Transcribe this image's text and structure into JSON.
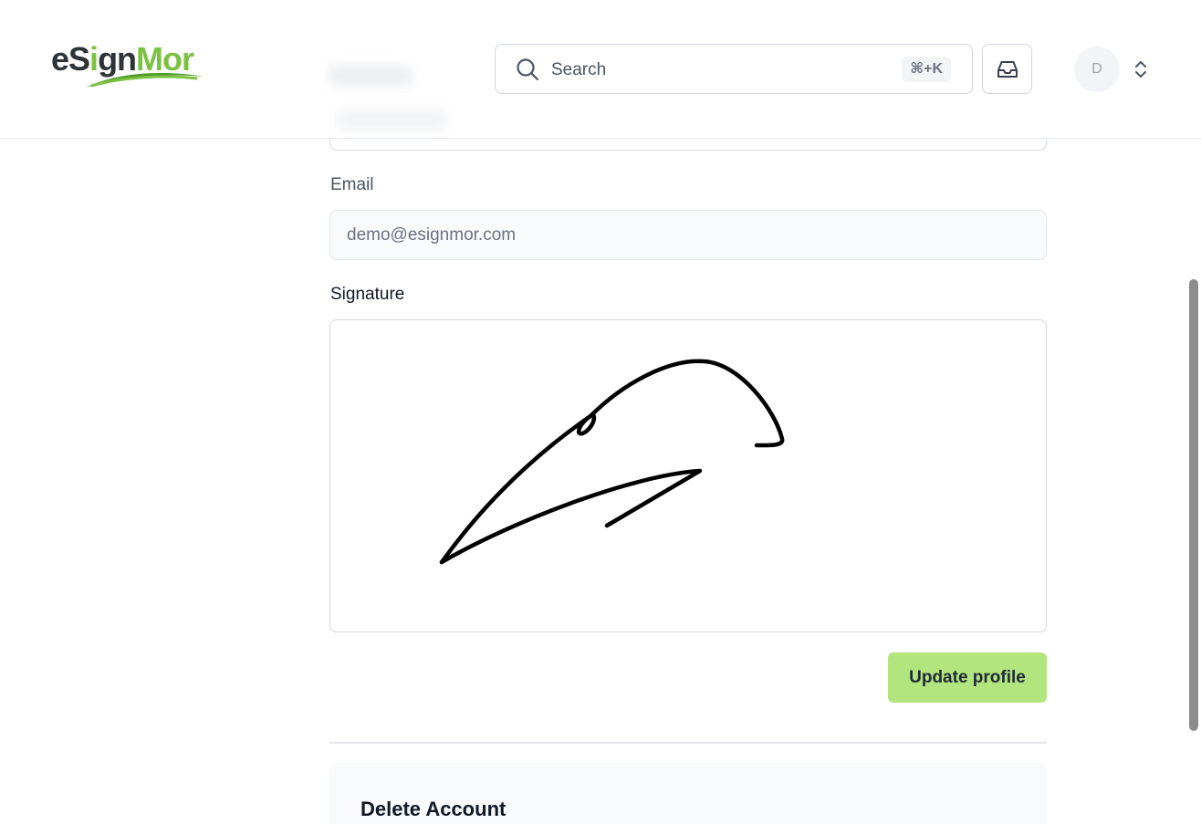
{
  "header": {
    "logo": {
      "part1": "eS",
      "part2": "i",
      "part3": "gn",
      "part4": "Mor"
    },
    "search": {
      "placeholder": "Search",
      "shortcut": "⌘+K"
    },
    "avatar_initial": "D"
  },
  "form": {
    "email_label": "Email",
    "email_value": "demo@esignmor.com",
    "signature_label": "Signature",
    "update_button": "Update profile"
  },
  "danger_zone": {
    "title": "Delete Account"
  },
  "colors": {
    "brand_green": "#7cc242",
    "button_green": "#b3e57e"
  },
  "icons": {
    "search": "search-icon",
    "inbox": "inbox-icon",
    "menu": "chevron-up-down-icon"
  }
}
